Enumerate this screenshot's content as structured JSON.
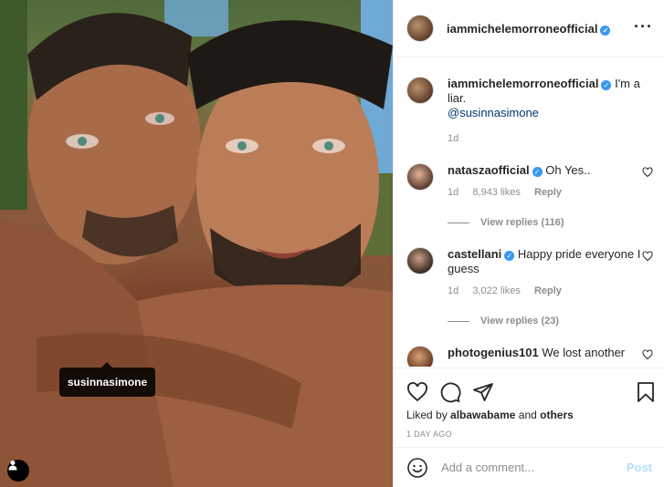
{
  "post": {
    "username": "iammichelemorroneofficial",
    "caption_text": "I'm a liar.",
    "caption_mention": "@susinnasimone",
    "caption_age": "1d",
    "tag_label": "susinnasimone"
  },
  "comments": [
    {
      "username": "natasza​official",
      "text": "Oh Yes..",
      "age": "1d",
      "likes": "8,943 likes",
      "reply_label": "Reply",
      "view_replies": "View replies (116)"
    },
    {
      "username": "castellani",
      "text": "Happy pride everyone I guess",
      "age": "1d",
      "likes": "3,022 likes",
      "reply_label": "Reply",
      "view_replies": "View replies (23)"
    },
    {
      "username": "photogenius101",
      "text": "We lost another"
    }
  ],
  "likes": {
    "prefix": "Liked by",
    "user": "albawabame",
    "joiner": "and",
    "others": "others"
  },
  "timestamp": "1 DAY AGO",
  "comment_box": {
    "placeholder": "Add a comment...",
    "post_label": "Post"
  },
  "colors": {
    "verified": "#3897f0",
    "link": "#00376b",
    "muted": "#8e8e8e",
    "post_disabled": "#b2dffc"
  }
}
